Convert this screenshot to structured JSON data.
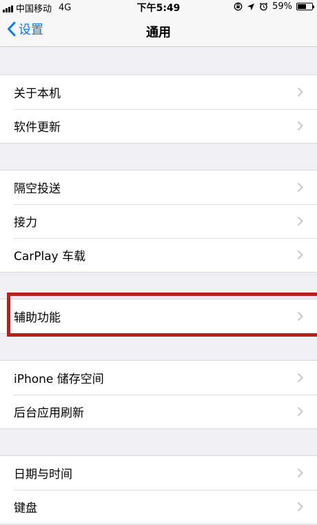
{
  "status": {
    "carrier": "中国移动",
    "network": "4G",
    "time": "下午5:49",
    "battery_percent": "59%",
    "battery_level": 0.59
  },
  "nav": {
    "back_label": "设置",
    "title": "通用"
  },
  "groups": [
    {
      "items": [
        {
          "label": "关于本机"
        },
        {
          "label": "软件更新"
        }
      ]
    },
    {
      "items": [
        {
          "label": "隔空投送"
        },
        {
          "label": "接力"
        },
        {
          "label": "CarPlay 车载"
        }
      ]
    },
    {
      "items": [
        {
          "label": "辅助功能"
        }
      ]
    },
    {
      "items": [
        {
          "label": "iPhone 储存空间"
        },
        {
          "label": "后台应用刷新"
        }
      ]
    },
    {
      "items": [
        {
          "label": "日期与时间"
        },
        {
          "label": "键盘"
        }
      ]
    }
  ],
  "colors": {
    "accent": "#007aff",
    "highlight": "#b8201f",
    "background": "#efeff4"
  }
}
